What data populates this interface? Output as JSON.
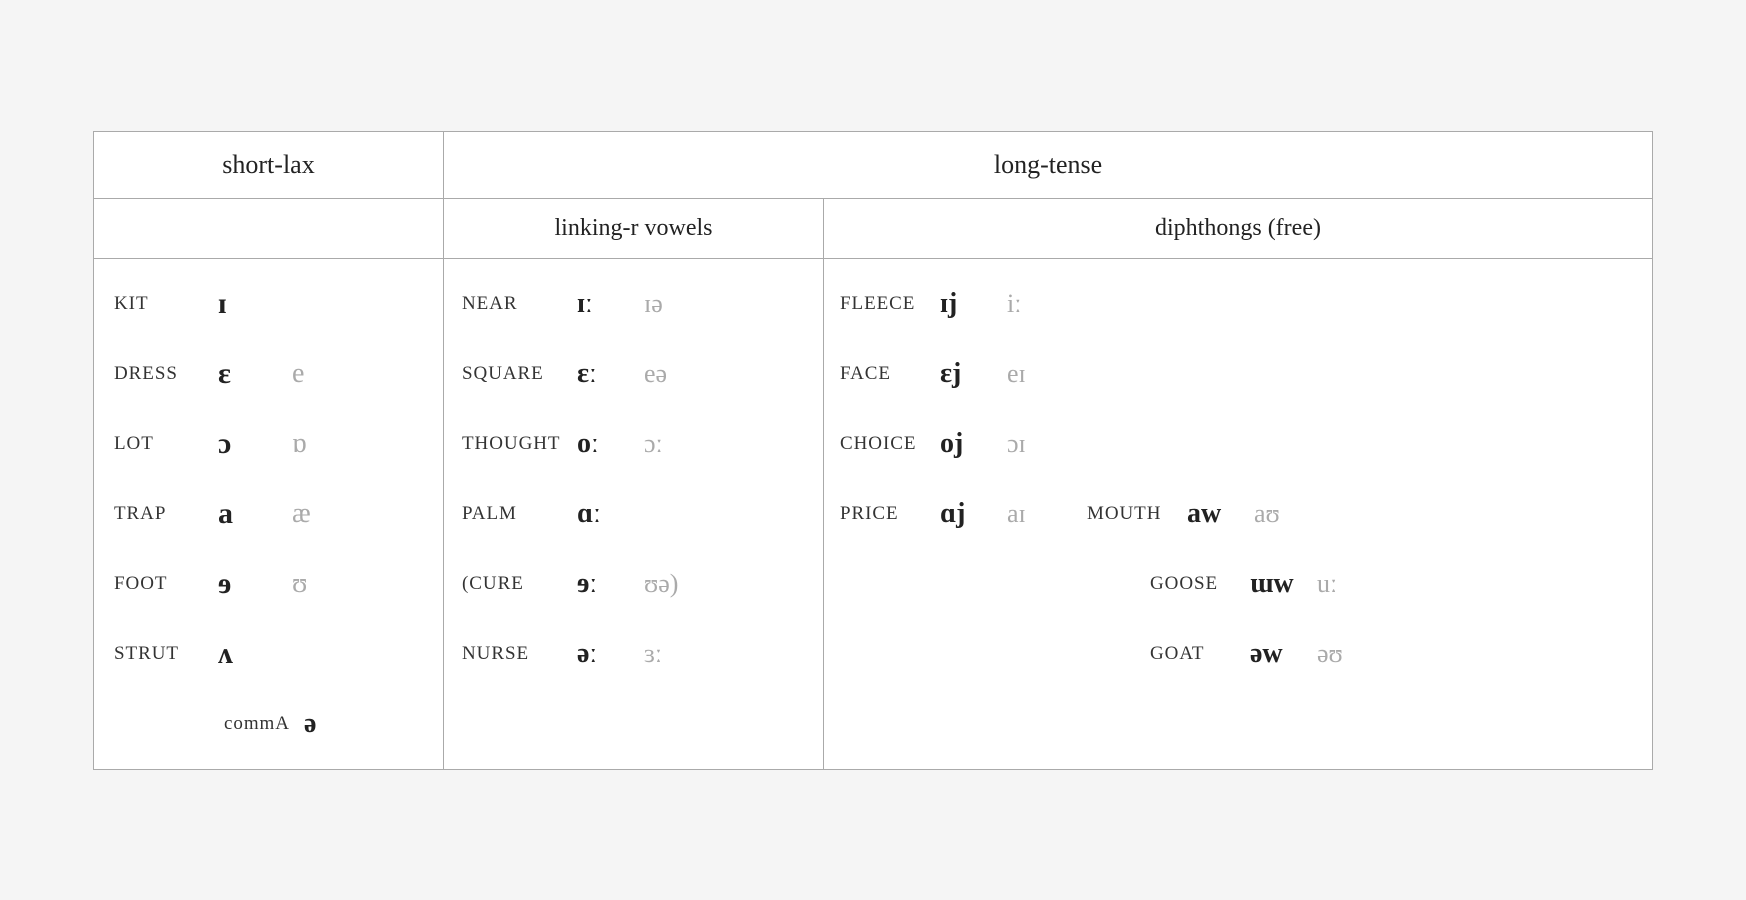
{
  "headers": {
    "short_lax": "short-lax",
    "long_tense": "long-tense",
    "linking_r": "linking-r vowels",
    "diphthongs": "diphthongs (free)"
  },
  "short_lax_rows": [
    {
      "word": "KIT",
      "primary": "ɪ",
      "secondary": ""
    },
    {
      "word": "DRESS",
      "primary": "ɛ",
      "secondary": "e"
    },
    {
      "word": "LOT",
      "primary": "ɔ",
      "secondary": "ɒ"
    },
    {
      "word": "TRAP",
      "primary": "a",
      "secondary": "æ"
    },
    {
      "word": "FOOT",
      "primary": "ɘ",
      "secondary": "ʊ"
    },
    {
      "word": "STRUT",
      "primary": "ʌ",
      "secondary": ""
    }
  ],
  "short_lax_comma": {
    "word": "commA",
    "ipa": "ə"
  },
  "linking_r_rows": [
    {
      "word": "NEAR",
      "primary": "ɪː",
      "secondary": "ɪə",
      "paren_open": false,
      "paren_close": false
    },
    {
      "word": "SQUARE",
      "primary": "ɛː",
      "secondary": "eə",
      "paren_open": false,
      "paren_close": false
    },
    {
      "word": "THOUGHT",
      "primary": "oː",
      "secondary": "ɔː",
      "paren_open": false,
      "paren_close": false
    },
    {
      "word": "PALM",
      "primary": "ɑː",
      "secondary": "",
      "paren_open": false,
      "paren_close": false
    },
    {
      "word": "CURE",
      "primary": "ɘː",
      "secondary": "ʊə",
      "paren_open": true,
      "paren_close": true
    },
    {
      "word": "NURSE",
      "primary": "əː",
      "secondary": "ɜː",
      "paren_open": false,
      "paren_close": false
    }
  ],
  "diphthong_rows": [
    {
      "left": {
        "word": "FLEECE",
        "primary": "ɪj",
        "secondary": "iː"
      },
      "right": null
    },
    {
      "left": {
        "word": "FACE",
        "primary": "ɛj",
        "secondary": "eɪ"
      },
      "right": null
    },
    {
      "left": {
        "word": "CHOICE",
        "primary": "oj",
        "secondary": "ɔɪ"
      },
      "right": null
    },
    {
      "left": {
        "word": "PRICE",
        "primary": "ɑj",
        "secondary": "aɪ"
      },
      "right": {
        "word": "MOUTH",
        "primary": "aw",
        "secondary": "aʊ"
      }
    },
    {
      "left": null,
      "right": {
        "word": "GOOSE",
        "primary": "ɯw",
        "secondary": "uː"
      }
    },
    {
      "left": null,
      "right": {
        "word": "GOAT",
        "primary": "əw",
        "secondary": "əʊ"
      }
    }
  ]
}
